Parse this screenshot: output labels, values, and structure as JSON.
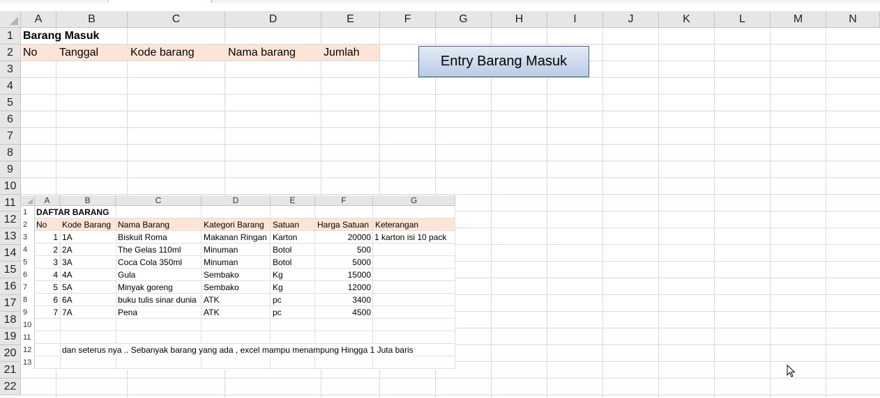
{
  "columns": [
    "A",
    "B",
    "C",
    "D",
    "E",
    "F",
    "G",
    "H",
    "I",
    "J",
    "K",
    "L",
    "M",
    "N"
  ],
  "rows": [
    "1",
    "2",
    "3",
    "4",
    "5",
    "6",
    "7",
    "8",
    "9",
    "10",
    "11",
    "12",
    "13",
    "14",
    "15",
    "16",
    "17",
    "18",
    "19",
    "20",
    "21",
    "22"
  ],
  "sheet": {
    "title": "Barang Masuk",
    "headers": [
      "No",
      "Tanggal",
      "Kode barang",
      "Nama barang",
      "Jumlah"
    ]
  },
  "entry_button": {
    "label": "Entry Barang Masuk"
  },
  "picture": {
    "columns": [
      "A",
      "B",
      "C",
      "D",
      "E",
      "F",
      "G"
    ],
    "rows": [
      "1",
      "2",
      "3",
      "4",
      "5",
      "6",
      "7",
      "8",
      "9",
      "10",
      "11",
      "12",
      "13"
    ],
    "title": "DAFTAR BARANG",
    "headers": [
      "No",
      "Kode Barang",
      "Nama Barang",
      "Kategori Barang",
      "Satuan",
      "Harga Satuan",
      "Keterangan"
    ],
    "items": [
      [
        "1",
        "1A",
        "Biskuit Roma",
        "Makanan Ringan",
        "Karton",
        "20000",
        "1 karton isi 10 pack"
      ],
      [
        "2",
        "2A",
        "The Gelas 110ml",
        "Minuman",
        "Botol",
        "500",
        ""
      ],
      [
        "3",
        "3A",
        "Coca Cola 350ml",
        "Minuman",
        "Botol",
        "5000",
        ""
      ],
      [
        "4",
        "4A",
        "Gula",
        "Sembako",
        "Kg",
        "15000",
        ""
      ],
      [
        "5",
        "5A",
        "Minyak goreng",
        "Sembako",
        "Kg",
        "12000",
        ""
      ],
      [
        "6",
        "6A",
        "buku tulis sinar dunia",
        "ATK",
        "pc",
        "3400",
        ""
      ],
      [
        "7",
        "7A",
        "Pena",
        "ATK",
        "pc",
        "4500",
        ""
      ]
    ],
    "note": "dan seterus nya  .. Sebanyak barang yang ada , excel mampu menampung Hingga  1 Juta  baris"
  },
  "icons": {
    "cursor": "mouse-pointer-icon"
  }
}
